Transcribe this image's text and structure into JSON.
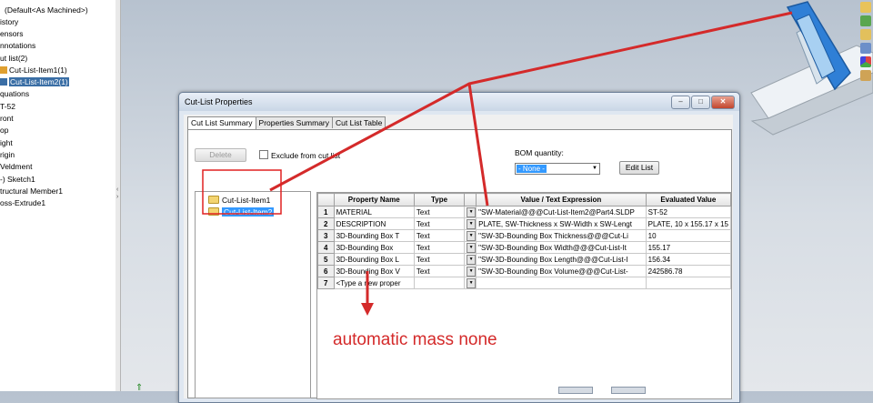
{
  "tree": {
    "items": [
      {
        "label": "(Default<As Machined>)",
        "selected": false,
        "icon": "config-icon"
      },
      {
        "label": "istory",
        "selected": false,
        "icon": "none"
      },
      {
        "label": "ensors",
        "selected": false,
        "icon": "none"
      },
      {
        "label": "nnotations",
        "selected": false,
        "icon": "none"
      },
      {
        "label": "ut list(2)",
        "selected": false,
        "icon": "none"
      },
      {
        "label": "Cut-List-Item1(1)",
        "selected": false,
        "icon": "cutlist-item-icon"
      },
      {
        "label": "Cut-List-Item2(1)",
        "selected": true,
        "icon": "cutlist-item-icon"
      },
      {
        "label": "quations",
        "selected": false,
        "icon": "none"
      },
      {
        "label": "T-52",
        "selected": false,
        "icon": "none"
      },
      {
        "label": "ront",
        "selected": false,
        "icon": "none"
      },
      {
        "label": "op",
        "selected": false,
        "icon": "none"
      },
      {
        "label": "ight",
        "selected": false,
        "icon": "none"
      },
      {
        "label": "rigin",
        "selected": false,
        "icon": "none"
      },
      {
        "label": "Veldment",
        "selected": false,
        "icon": "none"
      },
      {
        "label": "-) Sketch1",
        "selected": false,
        "icon": "none"
      },
      {
        "label": "tructural Member1",
        "selected": false,
        "icon": "none"
      },
      {
        "label": "oss-Extrude1",
        "selected": false,
        "icon": "none"
      }
    ]
  },
  "dialog": {
    "title": "Cut-List Properties",
    "window_buttons": [
      "–",
      "□",
      "✕"
    ],
    "tabs": [
      {
        "label": "Cut List Summary",
        "active": true
      },
      {
        "label": "Properties Summary",
        "active": false
      },
      {
        "label": "Cut List Table",
        "active": false
      }
    ],
    "delete_label": "Delete",
    "exclude_label": "Exclude from cut list",
    "bom_label": "BOM quantity:",
    "bom_value": "- None -",
    "edit_list_label": "Edit List",
    "list_items": [
      {
        "label": "Cut-List-Item1",
        "selected": false
      },
      {
        "label": "Cut-List-Item2",
        "selected": true
      }
    ],
    "grid": {
      "headers": [
        "",
        "Property Name",
        "Type",
        "",
        "Value / Text Expression",
        "Evaluated Value"
      ],
      "rows": [
        {
          "num": "1",
          "name": "MATERIAL",
          "type": "Text",
          "value": "\"SW-Material@@@Cut-List-Item2@Part4.SLDP",
          "evaluated": "ST-52"
        },
        {
          "num": "2",
          "name": "DESCRIPTION",
          "type": "Text",
          "value": "PLATE, SW-Thickness x SW-Width x SW-Lengt",
          "evaluated": "PLATE, 10 x 155.17 x 15"
        },
        {
          "num": "3",
          "name": "3D-Bounding Box T",
          "type": "Text",
          "value": "\"SW-3D-Bounding Box Thickness@@@Cut-Li",
          "evaluated": "10"
        },
        {
          "num": "4",
          "name": "3D-Bounding Box",
          "type": "Text",
          "value": "\"SW-3D-Bounding Box Width@@@Cut-List-It",
          "evaluated": "155.17"
        },
        {
          "num": "5",
          "name": "3D-Bounding Box L",
          "type": "Text",
          "value": "\"SW-3D-Bounding Box Length@@@Cut-List-I",
          "evaluated": "156.34"
        },
        {
          "num": "6",
          "name": "3D-Bounding Box V",
          "type": "Text",
          "value": "\"SW-3D-Bounding Box Volume@@@Cut-List-",
          "evaluated": "242586.78"
        },
        {
          "num": "7",
          "name": "<Type a new proper",
          "type": "",
          "value": "",
          "evaluated": ""
        }
      ]
    }
  },
  "annotation": "automatic mass none",
  "colors": {
    "accent": "#3399ff",
    "annotation": "#d42a2a",
    "tree_selection": "#3a6ea5"
  }
}
